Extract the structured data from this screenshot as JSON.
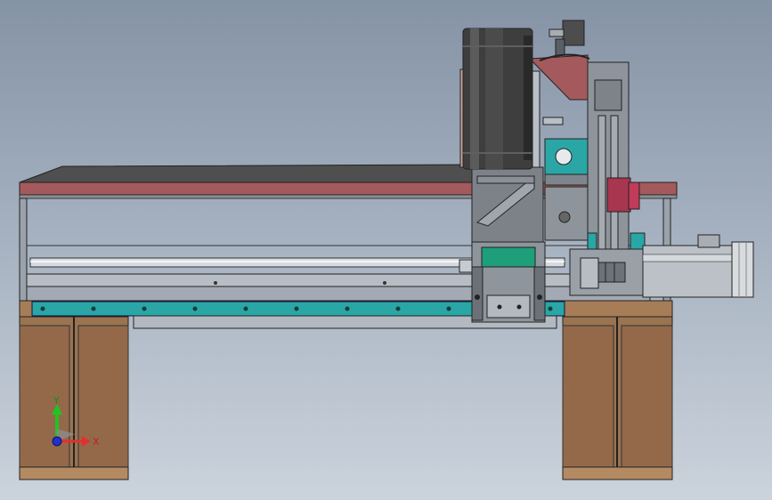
{
  "triad": {
    "y_label": "Y",
    "x_label": "X",
    "y_color": "#22c222",
    "x_color": "#e03030",
    "z_color": "#2030d0"
  },
  "colors": {
    "bed_top": "#555555",
    "bed_edge": "#a45a5c",
    "rail": "#2aa6a6",
    "leg": "#9a7350",
    "disc": "#3c3c3c",
    "motor": "#b8b8b8",
    "frame_line": "#222222"
  }
}
